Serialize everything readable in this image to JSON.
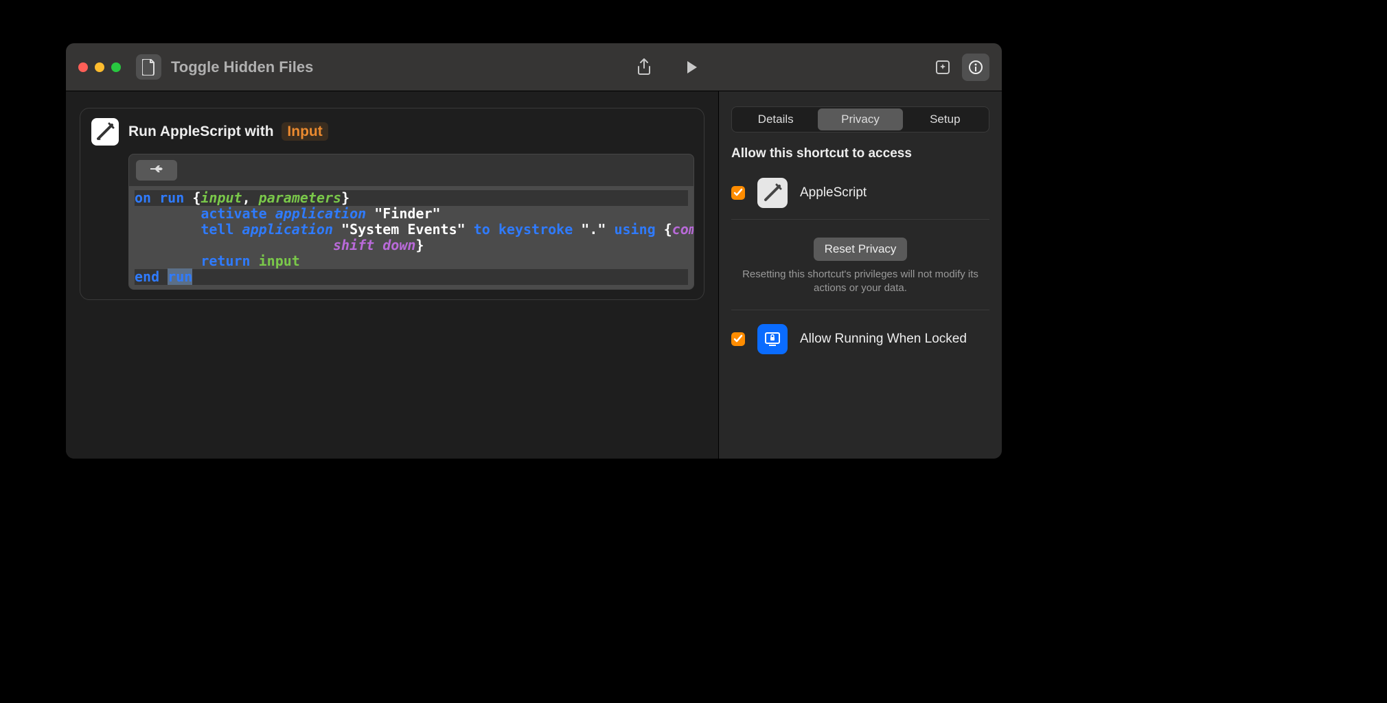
{
  "window": {
    "title": "Toggle Hidden Files"
  },
  "action": {
    "title_prefix": "Run AppleScript with",
    "input_token": "Input"
  },
  "script": {
    "l1_on": "on",
    "l1_run": "run",
    "l1_open": "{",
    "l1_input": "input",
    "l1_comma": ",",
    "l1_params": "parameters",
    "l1_close": "}",
    "l2_activate": "activate",
    "l2_application": "application",
    "l2_finder": "\"Finder\"",
    "l3_tell": "tell",
    "l3_application": "application",
    "l3_sysev": "\"System Events\"",
    "l3_to": "to",
    "l3_keystroke": "keystroke",
    "l3_dot": "\".\"",
    "l3_using": "using",
    "l3_open": "{",
    "l3_cmd": "command down",
    "l3_comma": ",",
    "l4_shift": "shift down",
    "l4_close": "}",
    "l5_return": "return",
    "l5_input": "input",
    "l6_end": "end",
    "l6_run": "run"
  },
  "sidebar": {
    "tabs": {
      "details": "Details",
      "privacy": "Privacy",
      "setup": "Setup"
    },
    "allow_label": "Allow this shortcut to access",
    "perm": {
      "applescript": "AppleScript"
    },
    "reset_btn": "Reset Privacy",
    "reset_note": "Resetting this shortcut's privileges will not modify its actions or your data.",
    "lock_label": "Allow Running When Locked"
  }
}
